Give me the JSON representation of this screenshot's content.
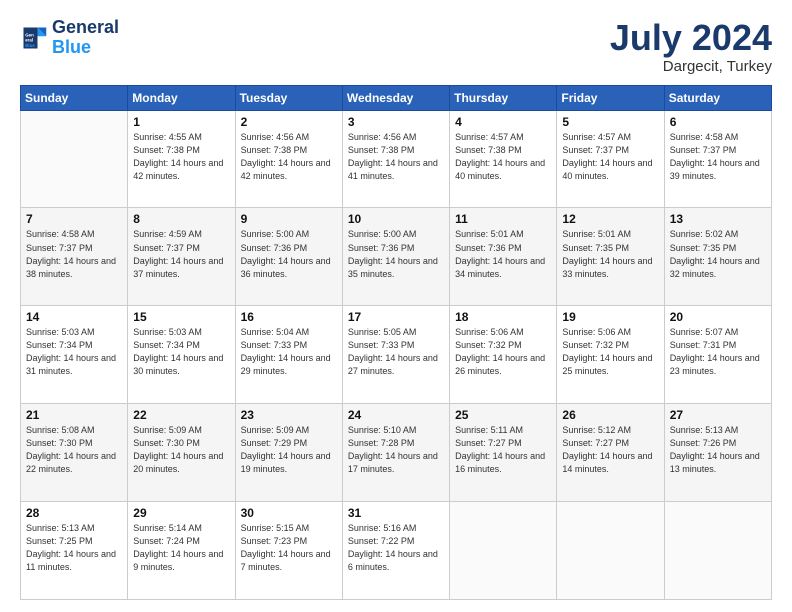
{
  "header": {
    "logo_line1": "General",
    "logo_line2": "Blue",
    "month_year": "July 2024",
    "location": "Dargecit, Turkey"
  },
  "days_of_week": [
    "Sunday",
    "Monday",
    "Tuesday",
    "Wednesday",
    "Thursday",
    "Friday",
    "Saturday"
  ],
  "weeks": [
    [
      {
        "day": "",
        "sunrise": "",
        "sunset": "",
        "daylight": ""
      },
      {
        "day": "1",
        "sunrise": "Sunrise: 4:55 AM",
        "sunset": "Sunset: 7:38 PM",
        "daylight": "Daylight: 14 hours and 42 minutes."
      },
      {
        "day": "2",
        "sunrise": "Sunrise: 4:56 AM",
        "sunset": "Sunset: 7:38 PM",
        "daylight": "Daylight: 14 hours and 42 minutes."
      },
      {
        "day": "3",
        "sunrise": "Sunrise: 4:56 AM",
        "sunset": "Sunset: 7:38 PM",
        "daylight": "Daylight: 14 hours and 41 minutes."
      },
      {
        "day": "4",
        "sunrise": "Sunrise: 4:57 AM",
        "sunset": "Sunset: 7:38 PM",
        "daylight": "Daylight: 14 hours and 40 minutes."
      },
      {
        "day": "5",
        "sunrise": "Sunrise: 4:57 AM",
        "sunset": "Sunset: 7:37 PM",
        "daylight": "Daylight: 14 hours and 40 minutes."
      },
      {
        "day": "6",
        "sunrise": "Sunrise: 4:58 AM",
        "sunset": "Sunset: 7:37 PM",
        "daylight": "Daylight: 14 hours and 39 minutes."
      }
    ],
    [
      {
        "day": "7",
        "sunrise": "Sunrise: 4:58 AM",
        "sunset": "Sunset: 7:37 PM",
        "daylight": "Daylight: 14 hours and 38 minutes."
      },
      {
        "day": "8",
        "sunrise": "Sunrise: 4:59 AM",
        "sunset": "Sunset: 7:37 PM",
        "daylight": "Daylight: 14 hours and 37 minutes."
      },
      {
        "day": "9",
        "sunrise": "Sunrise: 5:00 AM",
        "sunset": "Sunset: 7:36 PM",
        "daylight": "Daylight: 14 hours and 36 minutes."
      },
      {
        "day": "10",
        "sunrise": "Sunrise: 5:00 AM",
        "sunset": "Sunset: 7:36 PM",
        "daylight": "Daylight: 14 hours and 35 minutes."
      },
      {
        "day": "11",
        "sunrise": "Sunrise: 5:01 AM",
        "sunset": "Sunset: 7:36 PM",
        "daylight": "Daylight: 14 hours and 34 minutes."
      },
      {
        "day": "12",
        "sunrise": "Sunrise: 5:01 AM",
        "sunset": "Sunset: 7:35 PM",
        "daylight": "Daylight: 14 hours and 33 minutes."
      },
      {
        "day": "13",
        "sunrise": "Sunrise: 5:02 AM",
        "sunset": "Sunset: 7:35 PM",
        "daylight": "Daylight: 14 hours and 32 minutes."
      }
    ],
    [
      {
        "day": "14",
        "sunrise": "Sunrise: 5:03 AM",
        "sunset": "Sunset: 7:34 PM",
        "daylight": "Daylight: 14 hours and 31 minutes."
      },
      {
        "day": "15",
        "sunrise": "Sunrise: 5:03 AM",
        "sunset": "Sunset: 7:34 PM",
        "daylight": "Daylight: 14 hours and 30 minutes."
      },
      {
        "day": "16",
        "sunrise": "Sunrise: 5:04 AM",
        "sunset": "Sunset: 7:33 PM",
        "daylight": "Daylight: 14 hours and 29 minutes."
      },
      {
        "day": "17",
        "sunrise": "Sunrise: 5:05 AM",
        "sunset": "Sunset: 7:33 PM",
        "daylight": "Daylight: 14 hours and 27 minutes."
      },
      {
        "day": "18",
        "sunrise": "Sunrise: 5:06 AM",
        "sunset": "Sunset: 7:32 PM",
        "daylight": "Daylight: 14 hours and 26 minutes."
      },
      {
        "day": "19",
        "sunrise": "Sunrise: 5:06 AM",
        "sunset": "Sunset: 7:32 PM",
        "daylight": "Daylight: 14 hours and 25 minutes."
      },
      {
        "day": "20",
        "sunrise": "Sunrise: 5:07 AM",
        "sunset": "Sunset: 7:31 PM",
        "daylight": "Daylight: 14 hours and 23 minutes."
      }
    ],
    [
      {
        "day": "21",
        "sunrise": "Sunrise: 5:08 AM",
        "sunset": "Sunset: 7:30 PM",
        "daylight": "Daylight: 14 hours and 22 minutes."
      },
      {
        "day": "22",
        "sunrise": "Sunrise: 5:09 AM",
        "sunset": "Sunset: 7:30 PM",
        "daylight": "Daylight: 14 hours and 20 minutes."
      },
      {
        "day": "23",
        "sunrise": "Sunrise: 5:09 AM",
        "sunset": "Sunset: 7:29 PM",
        "daylight": "Daylight: 14 hours and 19 minutes."
      },
      {
        "day": "24",
        "sunrise": "Sunrise: 5:10 AM",
        "sunset": "Sunset: 7:28 PM",
        "daylight": "Daylight: 14 hours and 17 minutes."
      },
      {
        "day": "25",
        "sunrise": "Sunrise: 5:11 AM",
        "sunset": "Sunset: 7:27 PM",
        "daylight": "Daylight: 14 hours and 16 minutes."
      },
      {
        "day": "26",
        "sunrise": "Sunrise: 5:12 AM",
        "sunset": "Sunset: 7:27 PM",
        "daylight": "Daylight: 14 hours and 14 minutes."
      },
      {
        "day": "27",
        "sunrise": "Sunrise: 5:13 AM",
        "sunset": "Sunset: 7:26 PM",
        "daylight": "Daylight: 14 hours and 13 minutes."
      }
    ],
    [
      {
        "day": "28",
        "sunrise": "Sunrise: 5:13 AM",
        "sunset": "Sunset: 7:25 PM",
        "daylight": "Daylight: 14 hours and 11 minutes."
      },
      {
        "day": "29",
        "sunrise": "Sunrise: 5:14 AM",
        "sunset": "Sunset: 7:24 PM",
        "daylight": "Daylight: 14 hours and 9 minutes."
      },
      {
        "day": "30",
        "sunrise": "Sunrise: 5:15 AM",
        "sunset": "Sunset: 7:23 PM",
        "daylight": "Daylight: 14 hours and 7 minutes."
      },
      {
        "day": "31",
        "sunrise": "Sunrise: 5:16 AM",
        "sunset": "Sunset: 7:22 PM",
        "daylight": "Daylight: 14 hours and 6 minutes."
      },
      {
        "day": "",
        "sunrise": "",
        "sunset": "",
        "daylight": ""
      },
      {
        "day": "",
        "sunrise": "",
        "sunset": "",
        "daylight": ""
      },
      {
        "day": "",
        "sunrise": "",
        "sunset": "",
        "daylight": ""
      }
    ]
  ]
}
